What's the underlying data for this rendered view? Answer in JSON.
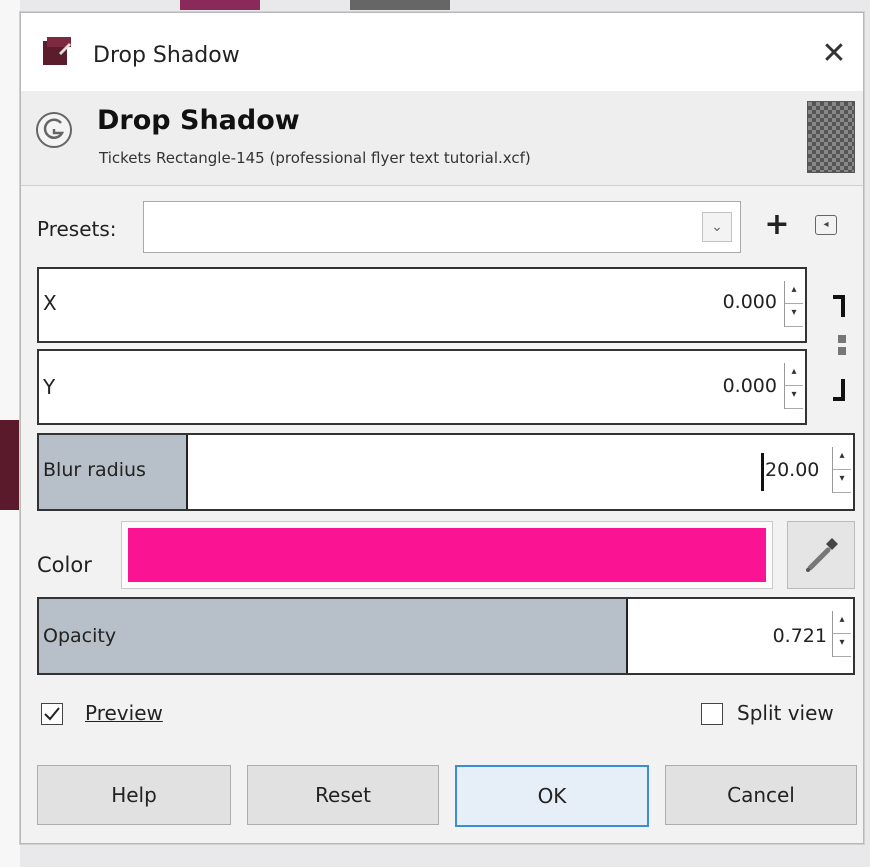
{
  "window": {
    "title": "Drop Shadow",
    "close_glyph": "✕"
  },
  "header": {
    "title": "Drop Shadow",
    "subtitle": "Tickets Rectangle-145 (professional flyer text tutorial.xcf)"
  },
  "presets": {
    "label": "Presets:",
    "value": "",
    "add_glyph": "+",
    "menu_glyph": "◂"
  },
  "fields": {
    "x": {
      "label": "X",
      "value": "0.000"
    },
    "y": {
      "label": "Y",
      "value": "0.000"
    },
    "blur_radius": {
      "label": "Blur radius",
      "value": "20.00",
      "fill_fraction": 0.18
    },
    "opacity": {
      "label": "Opacity",
      "value": "0.721",
      "fill_fraction": 0.721
    }
  },
  "color": {
    "label": "Color",
    "value": "#fa1493"
  },
  "checks": {
    "preview": {
      "label": "Preview",
      "checked": true
    },
    "split_view": {
      "label": "Split view",
      "checked": false
    }
  },
  "buttons": {
    "help": "Help",
    "reset": "Reset",
    "ok": "OK",
    "cancel": "Cancel"
  },
  "icons": {
    "app": "gimp-icon",
    "header": "filter-icon",
    "chain": "chain-link-icon",
    "pipette": "color-picker-icon",
    "spin": "spin-arrows-icon"
  },
  "colors": {
    "dialog_bg": "#f2f2f2",
    "scale_fill": "#b7c0c8",
    "default_button_border": "#3c8dd8"
  }
}
